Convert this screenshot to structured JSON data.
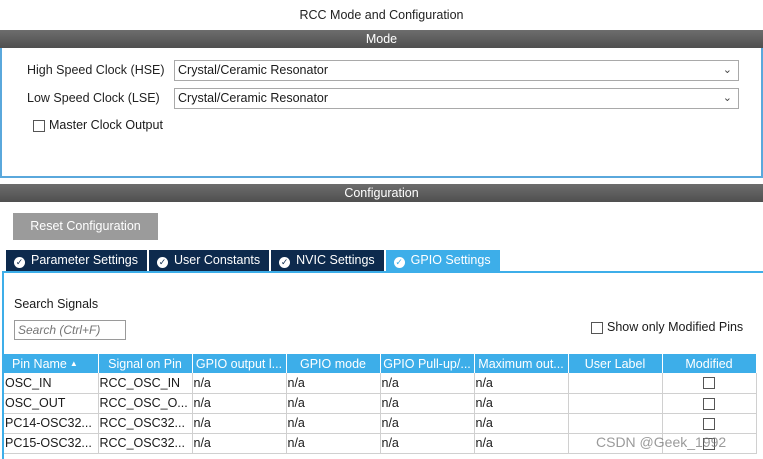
{
  "window": {
    "title": "RCC Mode and Configuration"
  },
  "mode": {
    "header": "Mode",
    "hse": {
      "label": "High Speed Clock (HSE)",
      "value": "Crystal/Ceramic Resonator"
    },
    "lse": {
      "label": "Low Speed Clock (LSE)",
      "value": "Crystal/Ceramic Resonator"
    },
    "master_clock_output": {
      "label": "Master Clock Output",
      "checked": false
    }
  },
  "configuration": {
    "header": "Configuration",
    "reset_label": "Reset Configuration",
    "tabs": [
      {
        "label": "Parameter Settings",
        "active": false
      },
      {
        "label": "User Constants",
        "active": false
      },
      {
        "label": "NVIC Settings",
        "active": false
      },
      {
        "label": "GPIO Settings",
        "active": true
      }
    ],
    "search": {
      "label": "Search Signals",
      "placeholder": "Search (Ctrl+F)"
    },
    "show_only_modified": {
      "label": "Show only Modified Pins",
      "checked": false
    },
    "table": {
      "columns": [
        "Pin Name",
        "Signal on Pin",
        "GPIO output l...",
        "GPIO mode",
        "GPIO Pull-up/...",
        "Maximum out...",
        "User Label",
        "Modified"
      ],
      "rows": [
        [
          "OSC_IN",
          "RCC_OSC_IN",
          "n/a",
          "n/a",
          "n/a",
          "n/a",
          "",
          false
        ],
        [
          "OSC_OUT",
          "RCC_OSC_O...",
          "n/a",
          "n/a",
          "n/a",
          "n/a",
          "",
          false
        ],
        [
          "PC14-OSC32...",
          "RCC_OSC32...",
          "n/a",
          "n/a",
          "n/a",
          "n/a",
          "",
          false
        ],
        [
          "PC15-OSC32...",
          "RCC_OSC32...",
          "n/a",
          "n/a",
          "n/a",
          "n/a",
          "",
          false
        ]
      ]
    }
  },
  "watermark": "CSDN @Geek_1992",
  "colors": {
    "accent": "#3daee9",
    "tab_dark": "#0d2a4d",
    "header_gray": "#5a5a5a",
    "button_gray": "#9b9b9b"
  }
}
